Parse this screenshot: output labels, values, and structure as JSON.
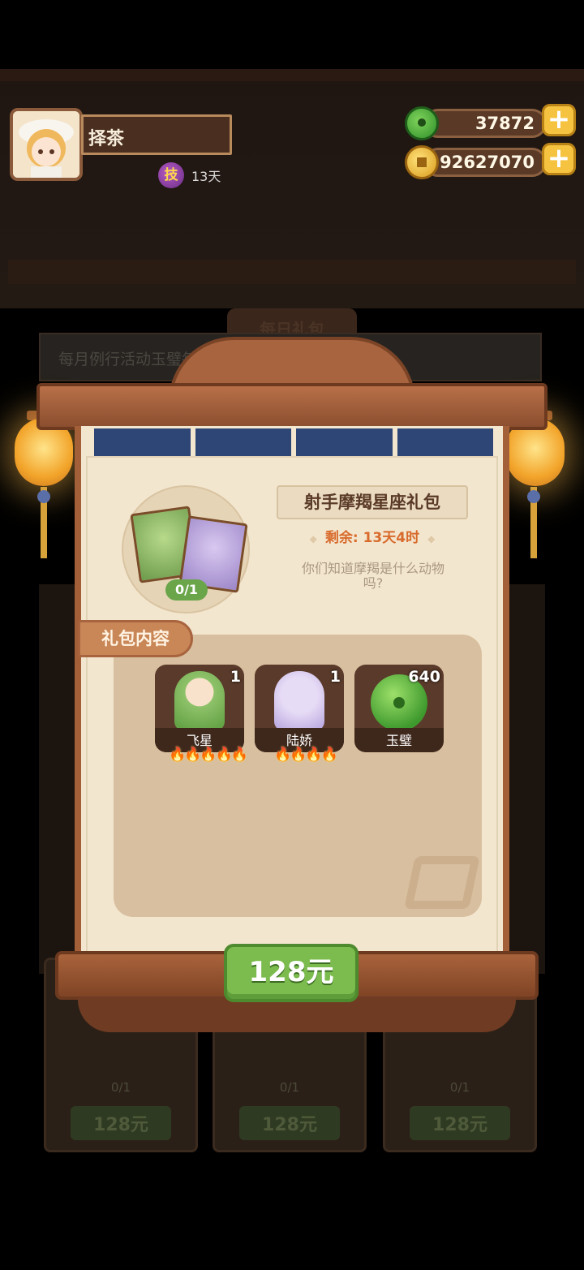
{
  "background": {
    "daily_gift_banner": "每日礼包",
    "notice_text": "每月例行活动玉璧每",
    "dim_cards": [
      {
        "count": "0/1",
        "price": "128元"
      },
      {
        "count": "0/1",
        "price": "128元"
      },
      {
        "count": "0/1",
        "price": "128元"
      }
    ]
  },
  "player": {
    "name": "择茶",
    "skill_badge": "技",
    "skill_days": "13天"
  },
  "resources": {
    "jade": "37872",
    "coins": "92627070",
    "plus_symbol": "+"
  },
  "pack": {
    "title": "射手摩羯星座礼包",
    "timer": "剩余: 13天4时",
    "timer_marker": "◆",
    "description": "你们知道摩羯是什么动物吗?",
    "progress": "0/1",
    "contents_label": "礼包内容",
    "items": [
      {
        "name": "飞星",
        "qty": "1",
        "stars": "🔥🔥🔥🔥🔥",
        "icon": "character-feixing-icon"
      },
      {
        "name": "陆娇",
        "qty": "1",
        "stars": "🔥🔥🔥🔥",
        "icon": "character-lujiao-icon"
      },
      {
        "name": "玉璧",
        "qty": "640",
        "stars": "",
        "icon": "jade-disc-icon"
      }
    ],
    "price_button": "128元"
  },
  "colors": {
    "accent_green": "#7cbc4e",
    "panel_paper": "#f3e6cf",
    "wood": "#a35f38",
    "timer_orange": "#d86b2c"
  }
}
